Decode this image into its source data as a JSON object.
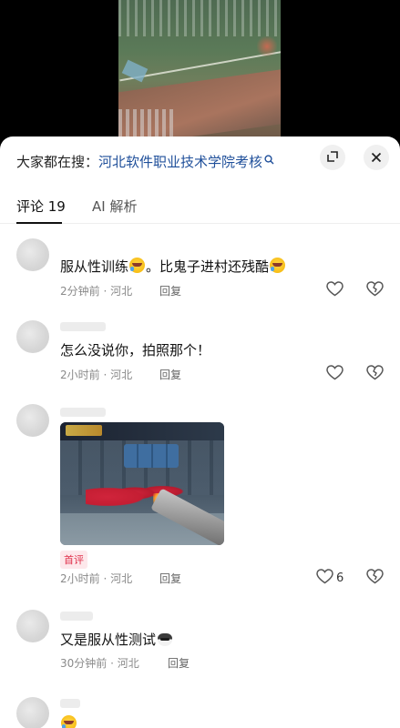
{
  "search": {
    "prefix": "大家都在搜：",
    "query": "河北软件职业技术学院考核"
  },
  "tabs": [
    {
      "label": "评论 19"
    },
    {
      "label": "AI 解析"
    }
  ],
  "comments": [
    {
      "text_a": "服从性训练",
      "text_b": "。比鬼子进村还残酷",
      "meta": "2分钟前 · 河北",
      "reply": "回复",
      "likes": ""
    },
    {
      "text": "怎么没说你，拍照那个！",
      "meta": "2小时前 · 河北",
      "reply": "回复",
      "likes": ""
    },
    {
      "badge": "首评",
      "meta": "2小时前 · 河北",
      "reply": "回复",
      "likes": "6"
    },
    {
      "text": "又是服从性测试",
      "meta": "30分钟前 · 河北",
      "reply": "回复",
      "likes": ""
    }
  ],
  "colors": {
    "link_blue": "#1f4f9a",
    "badge_red": "#e0324c"
  },
  "icons": {
    "expand": "expand-icon",
    "close": "close-icon",
    "like": "heart-icon",
    "dislike": "broken-heart-icon"
  }
}
